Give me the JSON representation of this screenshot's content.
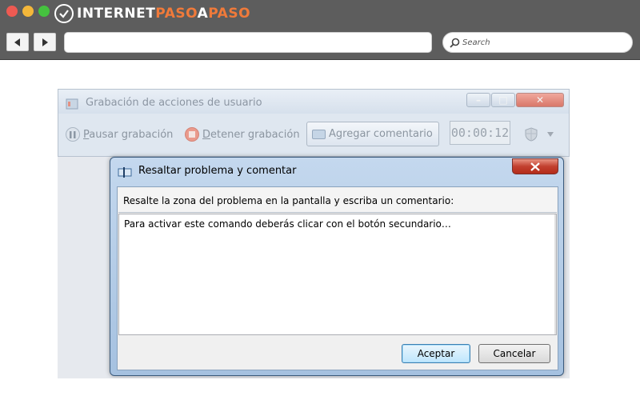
{
  "browser": {
    "logo": {
      "part1": "INTERNET",
      "part2": "PASO",
      "part3": "A",
      "part4": "PASO"
    },
    "search_label": "Search",
    "colors": {
      "chrome": "#5d5d5d",
      "accent": "#f07a3a"
    },
    "icons": {
      "back": "back-arrow-icon",
      "forward": "forward-arrow-icon",
      "search": "magnifier-icon"
    }
  },
  "recorder": {
    "title": "Grabación de acciones de usuario",
    "pause": {
      "mnemonic": "P",
      "rest": "ausar grabación"
    },
    "stop": {
      "mnemonic": "D",
      "rest": "etener grabación"
    },
    "add_comment": "Agregar comentario",
    "timer": "00:00:12"
  },
  "dialog": {
    "title": "Resaltar problema y comentar",
    "prompt": "Resalte la zona del problema en la pantalla y escriba un comentario:",
    "comment": "Para activar este comando deberás clicar con el botón secundario…",
    "ok_label": "Aceptar",
    "cancel_label": "Cancelar",
    "colors": {
      "title_bar": "#a5c1e0",
      "close": "#c2402f"
    }
  }
}
